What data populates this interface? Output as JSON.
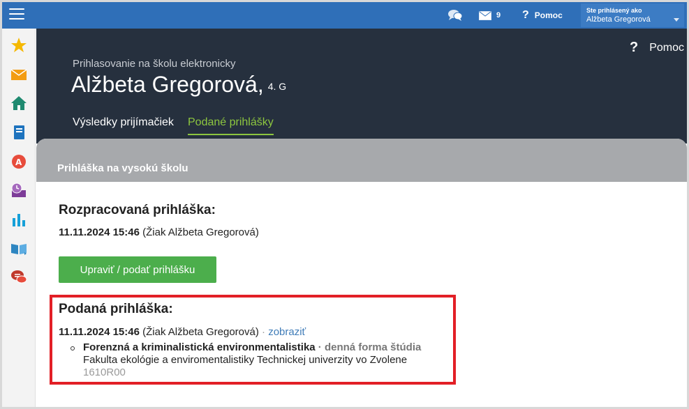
{
  "topbar": {
    "mail_count": "9",
    "help_label": "Pomoc",
    "user_label": "Ste prihlásený ako",
    "user_name": "Alžbeta Gregorová"
  },
  "sidebar": {
    "items": [
      "star-icon",
      "mail-icon",
      "home-icon",
      "notebook-icon",
      "grades-icon",
      "schedule-icon",
      "chart-icon",
      "book-icon",
      "chat-icon"
    ]
  },
  "header": {
    "help_label": "Pomoc",
    "subtitle": "Prihlasovanie na školu elektronicky",
    "student_name": "Alžbeta Gregorová,",
    "student_class": "4. G",
    "tabs": [
      {
        "label": "Výsledky prijímačiek",
        "active": false
      },
      {
        "label": "Podané prihlášky",
        "active": true
      }
    ]
  },
  "card": {
    "title": "Prihláška na vysokú školu",
    "draft": {
      "heading": "Rozpracovaná prihláška:",
      "datetime": "11.11.2024 15:46",
      "author": " (Žiak Alžbeta Gregorová)",
      "button_label": "Upraviť / podať prihlášku"
    },
    "submitted": {
      "heading": "Podaná prihláška:",
      "datetime": "11.11.2024 15:46",
      "author": " (Žiak Alžbeta Gregorová)",
      "separator": " · ",
      "view_link": "zobraziť",
      "program_name": "Forenzná a kriminalistická environmentalistika",
      "form_separator": " · ",
      "study_form": "denná forma štúdia",
      "faculty": "Fakulta ekológie a enviromentalistiky Technickej univerzity vo Zvolene",
      "code": "1610R00"
    }
  },
  "colors": {
    "topbar": "#2f6fb8",
    "header": "#26303e",
    "accent_green": "#8dc63f",
    "button_green": "#4cae4c",
    "highlight_red": "#e21f26",
    "link": "#3f7cb8"
  }
}
